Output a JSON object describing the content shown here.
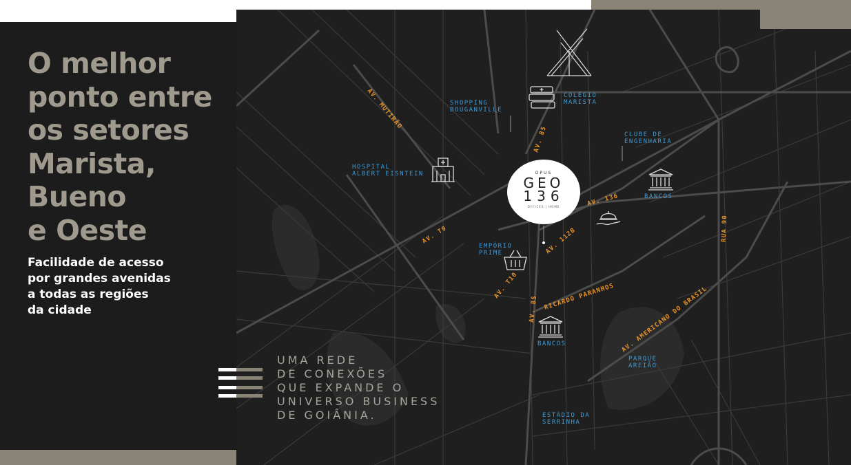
{
  "headline": [
    "O melhor",
    "ponto entre",
    "os setores",
    "Marista,",
    "Bueno",
    "e Oeste"
  ],
  "subheadline": [
    "Facilidade de acesso",
    "por grandes avenidas",
    "a todas as regiões",
    "da cidade"
  ],
  "tagline": [
    "UMA REDE",
    "DE CONEXÕES",
    "QUE EXPANDE O",
    "UNIVERSO BUSINESS",
    "DE GOIÂNIA."
  ],
  "logo": {
    "brand": "OPUS",
    "name": "GEO",
    "number": "136",
    "subtitle": "OFFICES | HOME"
  },
  "roads": {
    "mutirao": "AV. MUTIRÃO",
    "av85_top": "AV. 85",
    "av85_bottom": "AV. 85",
    "t9": "AV. T9",
    "t10": "AV. T10",
    "av136": "AV. 136",
    "av112b": "AV. 112B",
    "ricardo": "RICARDO PARANHOS",
    "americano": "AV. AMERICANO DO BRASIL",
    "rua90": "RUA 90"
  },
  "pois": {
    "shopping": [
      "SHOPPING",
      "BOUGANVILLE"
    ],
    "colegio": [
      "COLÉGIO",
      "MARISTA"
    ],
    "clube": [
      "CLUBE DE",
      "ENGENHARIA"
    ],
    "hospital": [
      "HOSPITAL",
      "ALBERT EISNTEIN"
    ],
    "bancos_top": "BANCOS",
    "emporio": [
      "EMPÓRIO",
      "PRIME"
    ],
    "bancos_bottom": "BANCOS",
    "parque": [
      "PARQUE",
      "AREIÃO"
    ],
    "estadio": [
      "ESTÁDIO DA",
      "SERRINHA"
    ]
  },
  "icons": [
    "compass-x-icon",
    "books-icon",
    "hospital-icon",
    "bank-icon",
    "cloche-icon",
    "basket-icon"
  ],
  "colors": {
    "panel": "#1c1c1c",
    "map": "#1f1f1f",
    "road_label": "#e8932a",
    "poi": "#3f9bd6",
    "headline": "#a09a8e",
    "accent_bar": "#8a8476"
  }
}
